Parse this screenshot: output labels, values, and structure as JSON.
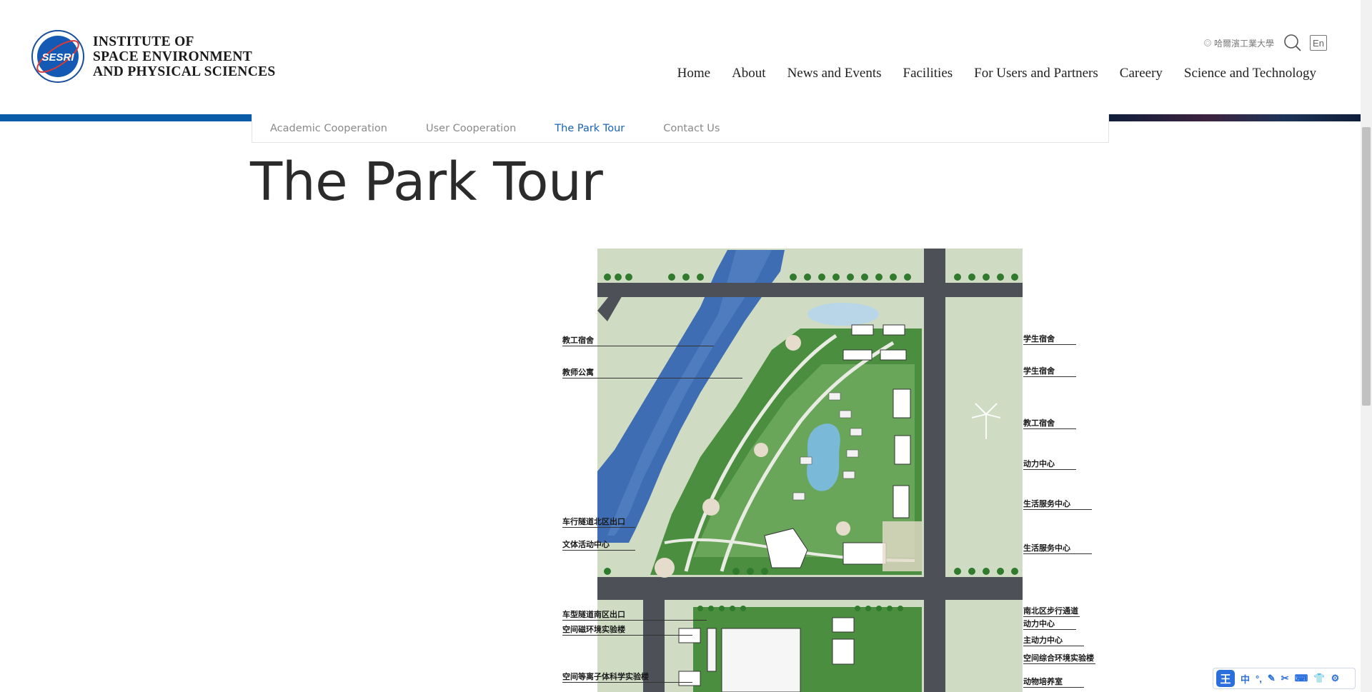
{
  "header": {
    "institute_name": [
      "INSTITUTE OF",
      "SPACE ENVIRONMENT",
      "AND PHYSICAL SCIENCES"
    ],
    "emblem_text": "SESRI",
    "university_logo_text": "哈爾濱工業大學",
    "lang_button": "En",
    "nav": [
      "Home",
      "About",
      "News and Events",
      "Facilities",
      "For Users and Partners",
      "Careery",
      "Science and Technology"
    ]
  },
  "sub_nav": {
    "items": [
      "Academic Cooperation",
      "User Cooperation",
      "The Park Tour",
      "Contact Us"
    ],
    "active": "The Park Tour"
  },
  "page": {
    "title": "The Park Tour"
  },
  "map_labels": {
    "left": [
      "教工宿舍",
      "教师公寓",
      "车行隧道北区出口",
      "文体活动中心",
      "车型隧道南区出口",
      "空间磁环境实验楼",
      "空间等离子体科学实验楼"
    ],
    "right": [
      "学生宿舍",
      "学生宿舍",
      "教工宿舍",
      "动力中心",
      "生活服务中心",
      "生活服务中心",
      "南北区步行通道",
      "动力中心",
      "主动力中心",
      "空间综合环境实验楼",
      "动物培养室"
    ]
  },
  "ime_toolbar": {
    "badge": "王",
    "items": [
      "中",
      "°,",
      "✎",
      "✂",
      "⌨",
      "👕",
      "⚙"
    ]
  },
  "colors": {
    "accent": "#1a63b5",
    "brand_bar": "#0a5ca8",
    "water": "#3f6db3",
    "road": "#4d5056",
    "green": "#3f8a3a"
  }
}
